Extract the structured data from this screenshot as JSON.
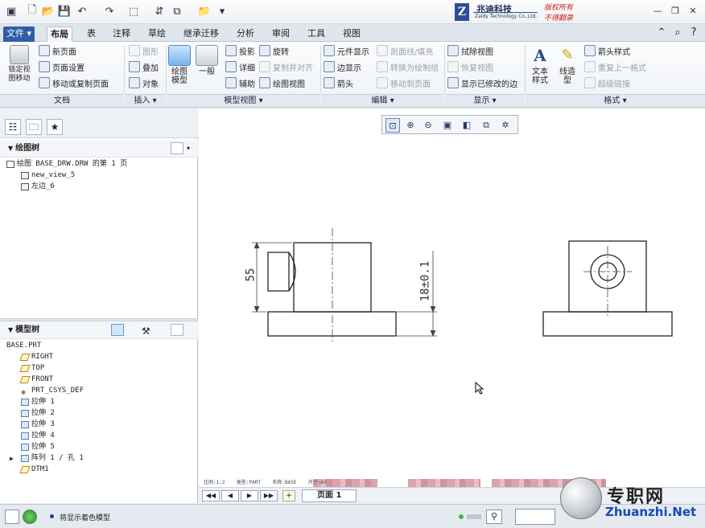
{
  "titlebar": {
    "logo_letter": "Z",
    "logo_cn": "兆迪科技",
    "logo_en": "Zaldy Technology Co.,Ltd.",
    "copyright1": "版权所有",
    "copyright2": "不得翻录",
    "win_min": "—",
    "win_restore": "❐",
    "win_close": "✕"
  },
  "tabs": [
    {
      "label": "文件 ▾"
    },
    {
      "label": "布局"
    },
    {
      "label": "表"
    },
    {
      "label": "注释"
    },
    {
      "label": "草绘"
    },
    {
      "label": "继承迁移"
    },
    {
      "label": "分析"
    },
    {
      "label": "审阅"
    },
    {
      "label": "工具"
    },
    {
      "label": "视图"
    }
  ],
  "tab_right_icons": [
    "⌃",
    "⌕",
    "?"
  ],
  "ribbon": {
    "lock_view": "锁定视\n图移动",
    "doc": {
      "new_page": "新页面",
      "page_setup": "页面设置",
      "move_copy_page": "移动或复制页面"
    },
    "insert": {
      "graphic": "图形",
      "overlay": "叠加",
      "object": "对象"
    },
    "model_views": {
      "drawing_model": "绘图\n模型",
      "general": "一般",
      "projection": "投影",
      "detailed": "详细",
      "auxiliary": "辅助",
      "revolve": "旋转",
      "copy_align": "复制并对齐",
      "drawing_view": "绘图视图"
    },
    "edit": {
      "element_display": "元件显示",
      "edge_display": "边显示",
      "arrow": "箭头",
      "section_hatch": "剖面线/填充",
      "convert_drawing": "转换为绘制组",
      "move_to_page": "移动到页面"
    },
    "display": {
      "erase_view": "拭除视图",
      "restore_view": "恢复视图",
      "show_modified_edges": "显示已修改的边"
    },
    "format": {
      "text_style": "文本\n样式",
      "line_style": "线造\n型",
      "arrow_style": "箭头样式",
      "repeat_format": "重复上一格式",
      "hyperlink": "超级链接"
    },
    "groups": {
      "doc": "文档",
      "insert": "插入 ▾",
      "model_views": "模型视图 ▾",
      "edit": "编辑 ▾",
      "display": "显示 ▾",
      "format": "格式 ▾"
    }
  },
  "drawing_tree": {
    "header": "绘图树",
    "items": [
      {
        "label": "绘图 BASE_DRW.DRW 的第 1 页"
      },
      {
        "label": "new_view_5"
      },
      {
        "label": "左边_6"
      }
    ]
  },
  "model_tree": {
    "header": "模型树",
    "root": "BASE.PRT",
    "items": [
      {
        "label": "RIGHT",
        "icon": "plane-icon"
      },
      {
        "label": "TOP",
        "icon": "plane-icon"
      },
      {
        "label": "FRONT",
        "icon": "plane-icon"
      },
      {
        "label": "PRT_CSYS_DEF",
        "icon": "csys-icon"
      },
      {
        "label": "拉伸 1",
        "icon": "extrude-icon"
      },
      {
        "label": "拉伸 2",
        "icon": "extrude-icon"
      },
      {
        "label": "拉伸 3",
        "icon": "extrude-icon"
      },
      {
        "label": "拉伸 4",
        "icon": "extrude-icon"
      },
      {
        "label": "拉伸 5",
        "icon": "extrude-icon"
      },
      {
        "label": "阵列 1 / 孔 1",
        "icon": "pattern-icon"
      },
      {
        "label": "DTM1",
        "icon": "plane-icon"
      }
    ]
  },
  "drawing": {
    "dim_55": "55",
    "dim_18": "18±0.1"
  },
  "canvas_status": "比例:1:2    类型:PART    名称:BASE    尺寸:A3",
  "pagebar": {
    "first": "◀◀",
    "prev": "◀",
    "next": "▶",
    "last": "▶▶",
    "page_label": "页面 1"
  },
  "statusbar": {
    "message": "将显示着色模型"
  },
  "watermark": {
    "cn": "专职网",
    "en": "Zhuanzhi.Net"
  }
}
